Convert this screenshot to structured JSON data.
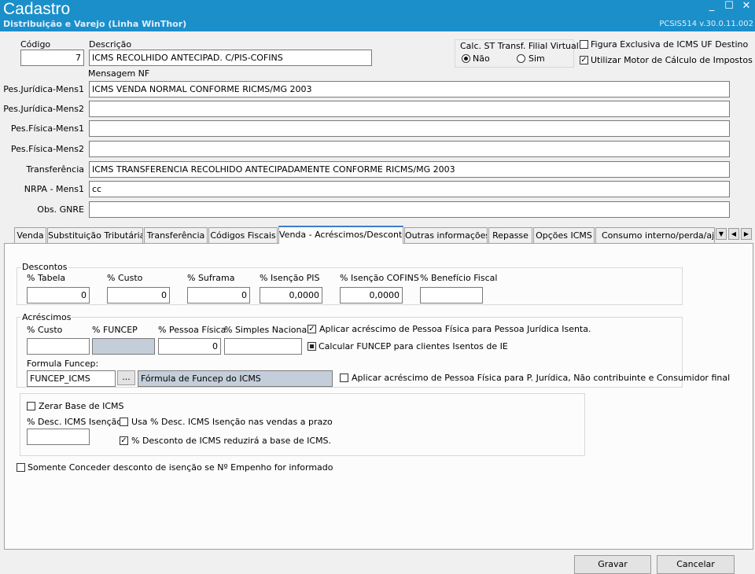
{
  "window": {
    "title": "Cadastro",
    "subtitle": "Distribuição e Varejo (Linha WinThor)",
    "version": "PCSIS514  v.30.0.11.002",
    "controls": {
      "minimize": "_",
      "maximize": "☐",
      "close": "✕"
    }
  },
  "header": {
    "codigo_label": "Código",
    "codigo_value": "7",
    "descricao_label": "Descrição",
    "descricao_value": "ICMS RECOLHIDO ANTECIPAD. C/PIS-COFINS",
    "calc_st_label": "Calc. ST Transf. Filial Virtual",
    "calc_st_options": [
      "Não",
      "Sim"
    ],
    "calc_st_selected": "Não",
    "figura_exclusiva_label": "Figura Exclusiva de ICMS UF Destino",
    "figura_exclusiva_checked": false,
    "utilizar_motor_label": "Utilizar Motor de Cálculo de Impostos",
    "utilizar_motor_checked": true
  },
  "mensagem_nf": {
    "label": "Mensagem NF",
    "rows": [
      {
        "label": "Pes.Jurídica-Mens1",
        "value": "ICMS  VENDA NORMAL  CONFORME RICMS/MG 2003"
      },
      {
        "label": "Pes.Jurídica-Mens2",
        "value": ""
      },
      {
        "label": "Pes.Física-Mens1",
        "value": ""
      },
      {
        "label": "Pes.Física-Mens2",
        "value": ""
      },
      {
        "label": "Transferência",
        "value": "ICMS  TRANSFERENCIA  RECOLHIDO ANTECIPADAMENTE CONFORME RICMS/MG 2003"
      },
      {
        "label": "NRPA - Mens1",
        "value": "cc"
      },
      {
        "label": "Obs. GNRE",
        "value": ""
      }
    ]
  },
  "tabs": [
    {
      "label": "Venda"
    },
    {
      "label": "Substituição Tributária"
    },
    {
      "label": "Transferência"
    },
    {
      "label": "Códigos Fiscais"
    },
    {
      "label": "Venda - Acréscimos/Descontos"
    },
    {
      "label": "Outras informações"
    },
    {
      "label": "Repasse"
    },
    {
      "label": "Opções ICMS"
    },
    {
      "label": "Consumo interno/perda/ajuste"
    }
  ],
  "active_tab": "Venda - Acréscimos/Descontos",
  "descontos": {
    "title": "Descontos",
    "fields": [
      {
        "label": "% Tabela",
        "value": "0"
      },
      {
        "label": "% Custo",
        "value": "0"
      },
      {
        "label": "% Suframa",
        "value": "0"
      },
      {
        "label": "% Isenção PIS",
        "value": "0,0000"
      },
      {
        "label": "% Isenção COFINS",
        "value": "0,0000"
      },
      {
        "label": "% Benefício Fiscal",
        "value": ""
      }
    ]
  },
  "acrescimos": {
    "title": "Acréscimos",
    "fields": [
      {
        "label": "% Custo",
        "value": ""
      },
      {
        "label": "% FUNCEP",
        "value": ""
      },
      {
        "label": "% Pessoa Física",
        "value": "0"
      },
      {
        "label": "% Simples Nacional",
        "value": ""
      }
    ],
    "aplicar_pf_pj_isenta_label": "Aplicar acréscimo de Pessoa Física para Pessoa Jurídica Isenta.",
    "aplicar_pf_pj_isenta_checked": true,
    "calcular_funcep_label": "Calcular FUNCEP para clientes Isentos de IE",
    "calcular_funcep_state": "indeterminate",
    "formula_label": "Formula Funcep:",
    "formula_value": "FUNCEP_ICMS",
    "formula_button": "...",
    "formula_desc": "Fórmula de Funcep do ICMS",
    "aplicar_pf_pj_nc_label": "Aplicar acréscimo de Pessoa Física para P. Jurídica, Não contribuinte e Consumidor final",
    "aplicar_pf_pj_nc_checked": false
  },
  "icms_base": {
    "zerar_base_label": "Zerar Base de ICMS",
    "zerar_base_checked": false,
    "desc_icms_label": "% Desc. ICMS Isenção",
    "desc_icms_value": "",
    "usa_desc_label": "Usa % Desc. ICMS Isenção nas vendas a prazo",
    "usa_desc_checked": false,
    "reduzira_label": "% Desconto de ICMS reduzirá a base de ICMS.",
    "reduzira_checked": true
  },
  "somente_conceder_label": "Somente Conceder desconto de isenção se Nº Empenho for informado",
  "somente_conceder_checked": false,
  "footer": {
    "gravar": "Gravar",
    "cancelar": "Cancelar"
  }
}
